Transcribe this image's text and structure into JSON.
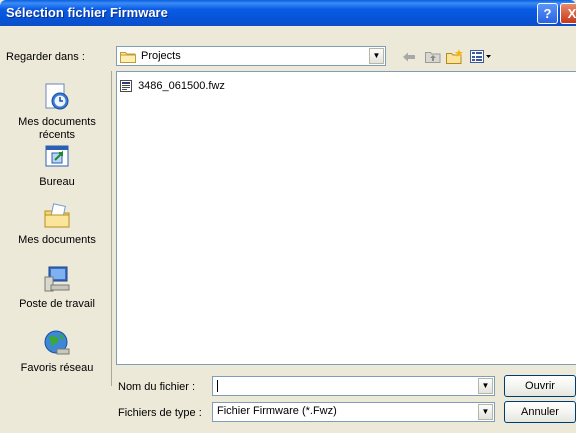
{
  "window": {
    "title": "Sélection fichier Firmware",
    "help_glyph": "?",
    "close_glyph": "X"
  },
  "lookin": {
    "label": "Regarder dans :",
    "value": "Projects"
  },
  "toolbar": {
    "back_icon": "back-arrow-icon",
    "up_icon": "up-folder-icon",
    "new_folder_icon": "new-folder-icon",
    "view_menu_icon": "view-menu-icon"
  },
  "places": [
    {
      "label": "Mes documents récents",
      "icon": "recent-documents-icon"
    },
    {
      "label": "Bureau",
      "icon": "desktop-icon"
    },
    {
      "label": "Mes documents",
      "icon": "my-documents-icon"
    },
    {
      "label": "Poste de travail",
      "icon": "my-computer-icon"
    },
    {
      "label": "Favoris réseau",
      "icon": "network-places-icon"
    }
  ],
  "files": [
    {
      "name": "3486_061500.fwz",
      "icon": "firmware-file-icon"
    }
  ],
  "filename": {
    "label": "Nom du fichier :",
    "value": ""
  },
  "filetype": {
    "label": "Fichiers de type :",
    "value": "Fichier Firmware (*.Fwz)"
  },
  "buttons": {
    "open": "Ouvrir",
    "cancel": "Annuler"
  },
  "colors": {
    "titlebar": "#0654d8",
    "dialog_bg": "#ece9d8",
    "field_border": "#7f9db9"
  }
}
